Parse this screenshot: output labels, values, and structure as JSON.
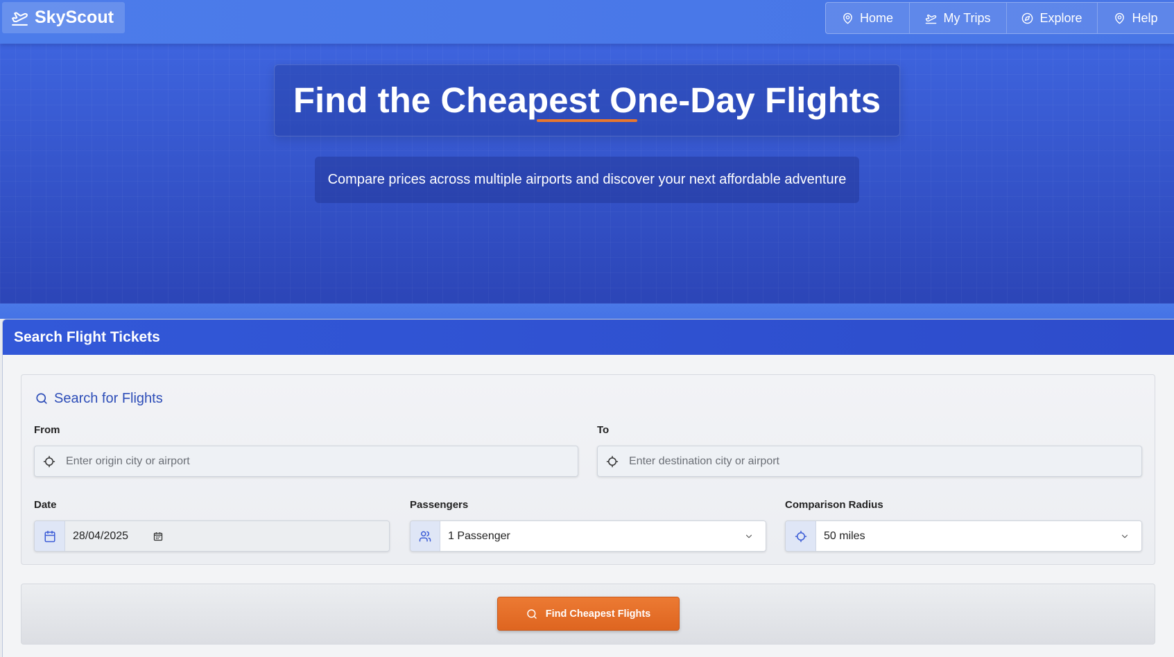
{
  "brand": {
    "name": "SkyScout",
    "icon": "plane-takeoff-icon"
  },
  "nav": {
    "items": [
      {
        "label": "Home",
        "icon": "map-pin-icon"
      },
      {
        "label": "My Trips",
        "icon": "plane-takeoff-icon"
      },
      {
        "label": "Explore",
        "icon": "compass-icon"
      },
      {
        "label": "Help",
        "icon": "map-pin-icon"
      }
    ]
  },
  "hero": {
    "title": "Find the Cheapest One-Day Flights",
    "subtitle": "Compare prices across multiple airports and discover your next affordable adventure"
  },
  "search_card": {
    "header": "Search Flight Tickets",
    "panel_title": "Search for Flights",
    "from": {
      "label": "From",
      "placeholder": "Enter origin city or airport",
      "icon": "crosshair-icon"
    },
    "to": {
      "label": "To",
      "placeholder": "Enter destination city or airport",
      "icon": "crosshair-icon"
    },
    "date": {
      "label": "Date",
      "value": "28/04/2025",
      "icon": "calendar-icon"
    },
    "passengers": {
      "label": "Passengers",
      "selected": "1 Passenger",
      "icon": "users-icon"
    },
    "radius": {
      "label": "Comparison Radius",
      "selected": "50 miles",
      "icon": "crosshair-icon"
    },
    "submit_label": "Find Cheapest Flights"
  },
  "colors": {
    "header": "#4c7cea",
    "hero": "#3e64de",
    "card_header": "#3258d8",
    "heading_text": "#2d4db8",
    "accent": "#e8772e",
    "button": "#e8702a"
  }
}
